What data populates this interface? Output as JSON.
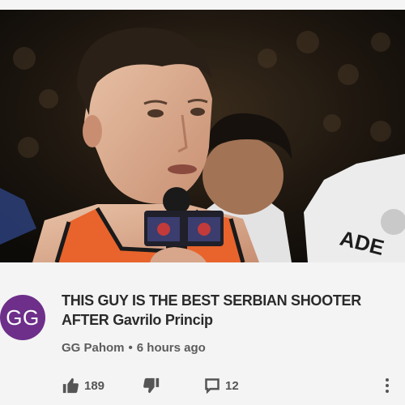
{
  "comment": {
    "avatar_initials": "GG",
    "avatar_color": "#6d2f8a",
    "text": "THIS GUY IS THE BEST SERBIAN SHOOTER AFTER Gavrilo Princip",
    "author": "GG Pahom",
    "separator": "•",
    "time": "6 hours ago",
    "likes": "189",
    "replies": "12"
  },
  "video": {
    "jersey_text": "ADE",
    "jersey_color": "#e8642c"
  },
  "icons": {
    "like": "thumbs-up-icon",
    "dislike": "thumbs-down-icon",
    "reply": "reply-icon",
    "more": "more-vertical-icon"
  }
}
